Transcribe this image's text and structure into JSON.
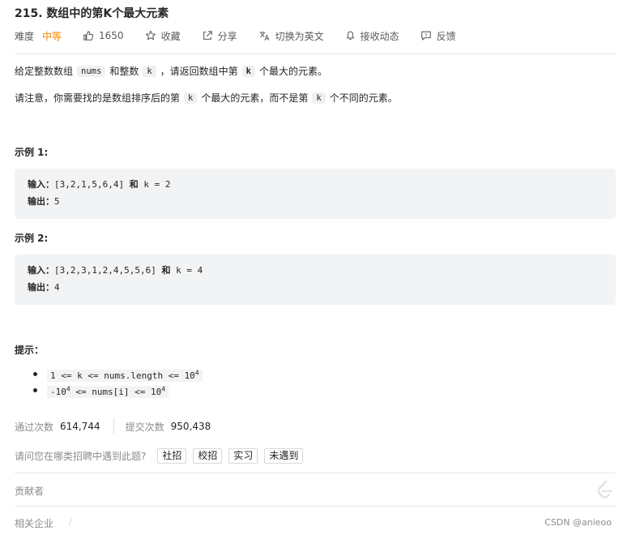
{
  "problem": {
    "title": "215. 数组中的第K个最大元素",
    "difficulty_label": "难度",
    "difficulty": "中等",
    "likes": "1650",
    "favorite_label": "收藏",
    "share_label": "分享",
    "switch_lang_label": "切换为英文",
    "notify_label": "接收动态",
    "feedback_label": "反馈",
    "difficulty_color": "#ff8800"
  },
  "description": {
    "p1_before": "给定整数数组",
    "p1_code1": "nums",
    "p1_mid": "和整数",
    "p1_code2": "k",
    "p1_mid2": "，请返回数组中第",
    "p1_code3": "k",
    "p1_after": "个最大的元素。",
    "p2_before": "请注意，你需要找的是数组排序后的第",
    "p2_code1": "k",
    "p2_mid": "个最大的元素，而不是第",
    "p2_code2": "k",
    "p2_after": "个不同的元素。"
  },
  "examples": [
    {
      "title": "示例 1:",
      "input_label": "输入：",
      "input": "[3,2,1,5,6,4]",
      "and_word": "和",
      "k_part": "k = 2",
      "output_label": "输出：",
      "output": "5"
    },
    {
      "title": "示例 2:",
      "input_label": "输入：",
      "input": "[3,2,3,1,2,4,5,5,6]",
      "and_word": "和",
      "k_part": "k = 4",
      "output_label": "输出：",
      "output": "4"
    }
  ],
  "hints": {
    "title": "提示：",
    "h1_text": "1 <= k <= nums.length <= 10",
    "h1_sup": "4",
    "h2_pre": "-10",
    "h2_sup": "4",
    "h2_text": " <= nums[i] <= 10",
    "h2_sup2": "4"
  },
  "stats": {
    "accepted_label": "通过次数",
    "accepted": "614,744",
    "submitted_label": "提交次数",
    "submitted": "950,438"
  },
  "interview": {
    "question": "请问您在哪类招聘中遇到此题?",
    "tags": [
      "社招",
      "校招",
      "实习",
      "未遇到"
    ]
  },
  "sections": {
    "contributors": "贡献者",
    "related_companies": "相关企业"
  },
  "watermark": "CSDN @anieoo"
}
